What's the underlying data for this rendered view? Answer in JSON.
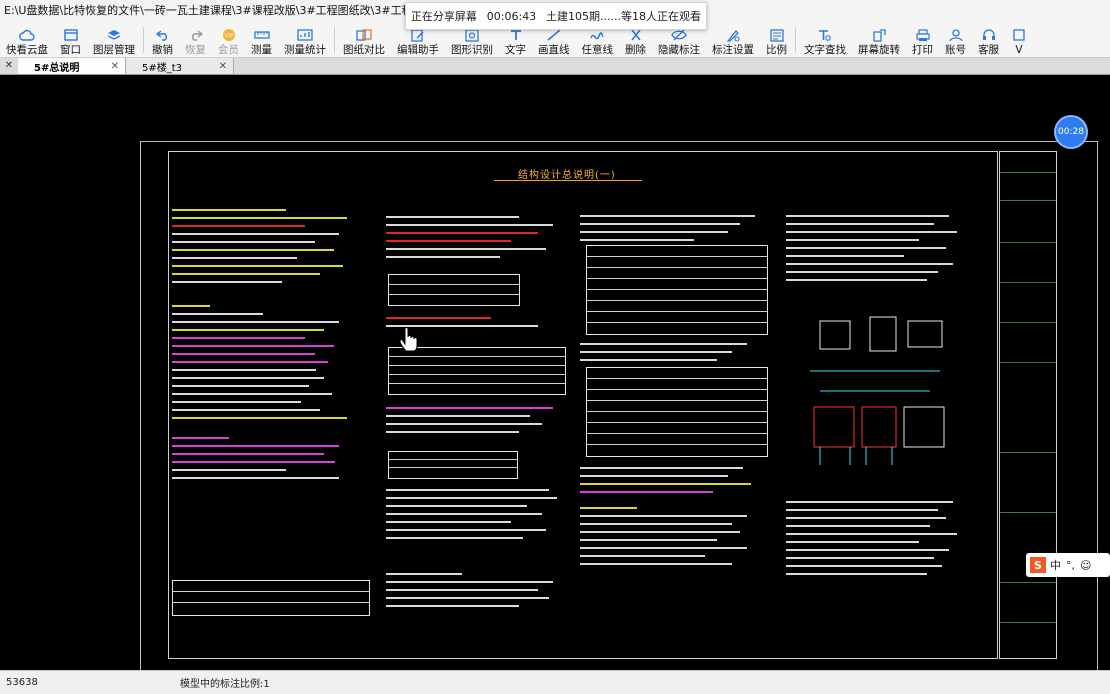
{
  "window": {
    "title": "E:\\U盘数据\\比特恢复的文件\\一砖一瓦土建课程\\3#课程改版\\3#工程图纸改\\3#工程图纸\\5#"
  },
  "share_overlay": {
    "status": "正在分享屏幕",
    "elapsed": "00:06:43",
    "viewers": "土建105期......等18人正在观看"
  },
  "toolbar": {
    "items": [
      {
        "label": "快看云盘",
        "icon": "cloud-icon"
      },
      {
        "label": "窗口",
        "icon": "window-icon"
      },
      {
        "label": "图层管理",
        "icon": "layers-icon"
      },
      {
        "label": "撤销",
        "icon": "undo-icon"
      },
      {
        "label": "恢复",
        "icon": "redo-icon",
        "disabled": true
      },
      {
        "label": "会员",
        "icon": "vip-icon",
        "disabled": true
      },
      {
        "label": "测量",
        "icon": "ruler-icon"
      },
      {
        "label": "测量统计",
        "icon": "measure-stats-icon"
      },
      {
        "label": "图纸对比",
        "icon": "compare-icon"
      },
      {
        "label": "编辑助手",
        "icon": "edit-helper-icon"
      },
      {
        "label": "图形识别",
        "icon": "shape-recognize-icon"
      },
      {
        "label": "文字",
        "icon": "text-icon"
      },
      {
        "label": "画直线",
        "icon": "line-icon"
      },
      {
        "label": "任意线",
        "icon": "freehand-icon"
      },
      {
        "label": "删除",
        "icon": "delete-icon"
      },
      {
        "label": "隐藏标注",
        "icon": "hide-annotation-icon"
      },
      {
        "label": "标注设置",
        "icon": "annotation-settings-icon"
      },
      {
        "label": "比例",
        "icon": "scale-icon"
      },
      {
        "label": "文字查找",
        "icon": "text-search-icon"
      },
      {
        "label": "屏幕旋转",
        "icon": "rotate-icon"
      },
      {
        "label": "打印",
        "icon": "print-icon"
      },
      {
        "label": "账号",
        "icon": "account-icon"
      },
      {
        "label": "客服",
        "icon": "support-icon"
      },
      {
        "label": "V",
        "icon": "more-icon"
      }
    ]
  },
  "tabs": [
    {
      "label": "5#总说明",
      "active": true
    },
    {
      "label": "5#楼_t3",
      "active": false
    }
  ],
  "drawing": {
    "title": "结构设计总说明(一)"
  },
  "timer_badge": "00:28",
  "ime": {
    "logo": "S",
    "mode": "中",
    "punct": "°,",
    "emoji": "☺"
  },
  "status": {
    "coordinate": "53638",
    "scale_text": "模型中的标注比例:1"
  },
  "colors": {
    "canvas": "#000000",
    "cad_yellow": "#ffff33",
    "cad_white": "#f2f2f2",
    "cad_cyan": "#33e0e6",
    "cad_magenta": "#ff4dff",
    "cad_red": "#ff3030",
    "cad_orange": "#ffb020",
    "accent_blue": "#2d7cf0"
  }
}
